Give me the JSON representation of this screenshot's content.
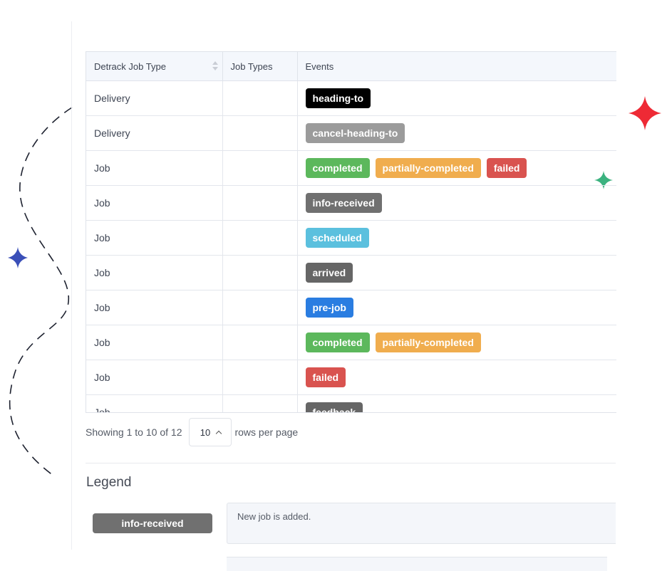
{
  "table": {
    "headers": [
      "Detrack Job Type",
      "Job Types",
      "Events"
    ],
    "rows": [
      {
        "type": "Delivery",
        "job_types": "",
        "events": [
          {
            "label": "heading-to",
            "color": "#000000"
          }
        ]
      },
      {
        "type": "Delivery",
        "job_types": "",
        "events": [
          {
            "label": "cancel-heading-to",
            "color": "#9b9b9b"
          }
        ]
      },
      {
        "type": "Job",
        "job_types": "",
        "events": [
          {
            "label": "completed",
            "color": "#5cb85c"
          },
          {
            "label": "partially-completed",
            "color": "#f0ad4e"
          },
          {
            "label": "failed",
            "color": "#d9534f"
          }
        ]
      },
      {
        "type": "Job",
        "job_types": "",
        "events": [
          {
            "label": "info-received",
            "color": "#707070"
          }
        ]
      },
      {
        "type": "Job",
        "job_types": "",
        "events": [
          {
            "label": "scheduled",
            "color": "#5bc0de"
          }
        ]
      },
      {
        "type": "Job",
        "job_types": "",
        "events": [
          {
            "label": "arrived",
            "color": "#666666"
          }
        ]
      },
      {
        "type": "Job",
        "job_types": "",
        "events": [
          {
            "label": "pre-job",
            "color": "#2a7de1"
          }
        ]
      },
      {
        "type": "Job",
        "job_types": "",
        "events": [
          {
            "label": "completed",
            "color": "#5cb85c"
          },
          {
            "label": "partially-completed",
            "color": "#f0ad4e"
          }
        ]
      },
      {
        "type": "Job",
        "job_types": "",
        "events": [
          {
            "label": "failed",
            "color": "#d9534f"
          }
        ]
      },
      {
        "type": "Job",
        "job_types": "",
        "events": [
          {
            "label": "feedback",
            "color": "#666666"
          }
        ]
      }
    ]
  },
  "pagination": {
    "showing_prefix": "Showing",
    "from": "1",
    "to_word": "to",
    "to": "10",
    "of_word": "of",
    "total": "12",
    "rows_per_page": "10",
    "rows_label": "rows per page"
  },
  "legend": {
    "title": "Legend",
    "items": [
      {
        "label": "info-received",
        "color": "#707070",
        "description": "New job is added."
      }
    ]
  },
  "decorations": {
    "sparkle_red": "#ee2a35",
    "sparkle_green": "#3bb27f",
    "sparkle_blue": "#3a4fb8"
  }
}
